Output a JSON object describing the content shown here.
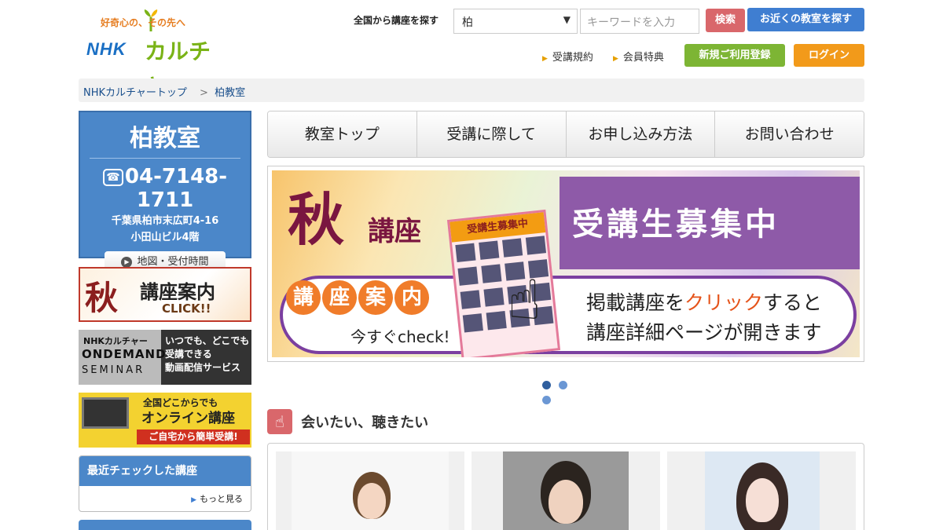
{
  "header": {
    "logo_tagline": "好奇心の、その先へ",
    "logo_nhk": "NHK",
    "logo_culture": "カルチャー",
    "search_label": "全国から講座を探す",
    "select_value": "柏",
    "keyword_placeholder": "キーワードを入力",
    "search_button": "検索",
    "near_button": "お近くの教室を探す",
    "links": [
      "受講規約",
      "会員特典"
    ],
    "register_button": "新規ご利用登録",
    "login_button": "ログイン"
  },
  "breadcrumb": {
    "home": "NHKカルチャートップ",
    "separator": ">",
    "current": "柏教室"
  },
  "sidebar": {
    "class_name": "柏教室",
    "phone": "04-7148-1711",
    "address_line1": "千葉県柏市末広町4-16",
    "address_line2": "小田山ビル4階",
    "map_button": "地図・受付時間",
    "banner_aki": {
      "big": "秋",
      "text": "講座案内",
      "click": "CLICK!!"
    },
    "banner_ondemand": {
      "brand": "NHKカルチャー",
      "title": "ONDEMAND",
      "sub": "SEMINAR",
      "desc1": "いつでも、どこでも",
      "desc2": "受講できる",
      "desc3": "動画配信サービス"
    },
    "banner_online": {
      "line1": "全国どこからでも",
      "line2": "オンライン講座",
      "line3": "ご自宅から簡単受講!"
    },
    "recent_title": "最近チェックした講座",
    "recent_more": "もっと見る"
  },
  "tabs": [
    "教室トップ",
    "受講に際して",
    "お申し込み方法",
    "お問い合わせ"
  ],
  "hero": {
    "aki": "秋",
    "koza": "講座",
    "boshu": "受講生募集中",
    "pill_chars": [
      "講",
      "座",
      "案",
      "内"
    ],
    "check": "今すぐcheck!",
    "flyer_title": "受講生募集中",
    "desc_line1_pre": "掲載講座を",
    "desc_line1_red": "クリック",
    "desc_line1_post": "すると",
    "desc_line2": "講座詳細ページが開きます"
  },
  "carousel": {
    "count": 3,
    "active": 1
  },
  "section": {
    "title": "会いたい、聴きたい",
    "icon": "pointing-hand-icon"
  },
  "colors": {
    "brand_blue": "#4b87c9",
    "search_red": "#d9676b",
    "register_green": "#7db534",
    "login_orange": "#f29a1a"
  }
}
